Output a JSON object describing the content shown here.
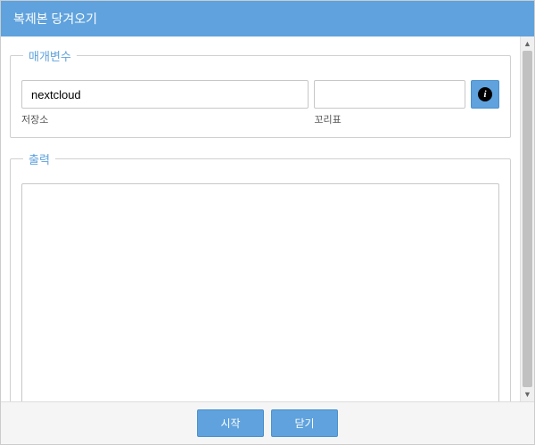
{
  "title": "복제본 당겨오기",
  "params": {
    "legend": "매개변수",
    "repo": {
      "value": "nextcloud",
      "label": "저장소"
    },
    "tag": {
      "value": "",
      "label": "꼬리표"
    },
    "info_icon": "info-icon"
  },
  "output": {
    "legend": "출력",
    "content": ""
  },
  "footer": {
    "start": "시작",
    "close": "닫기"
  },
  "colors": {
    "primary": "#5fa2dd",
    "border": "#c7c7c7"
  }
}
